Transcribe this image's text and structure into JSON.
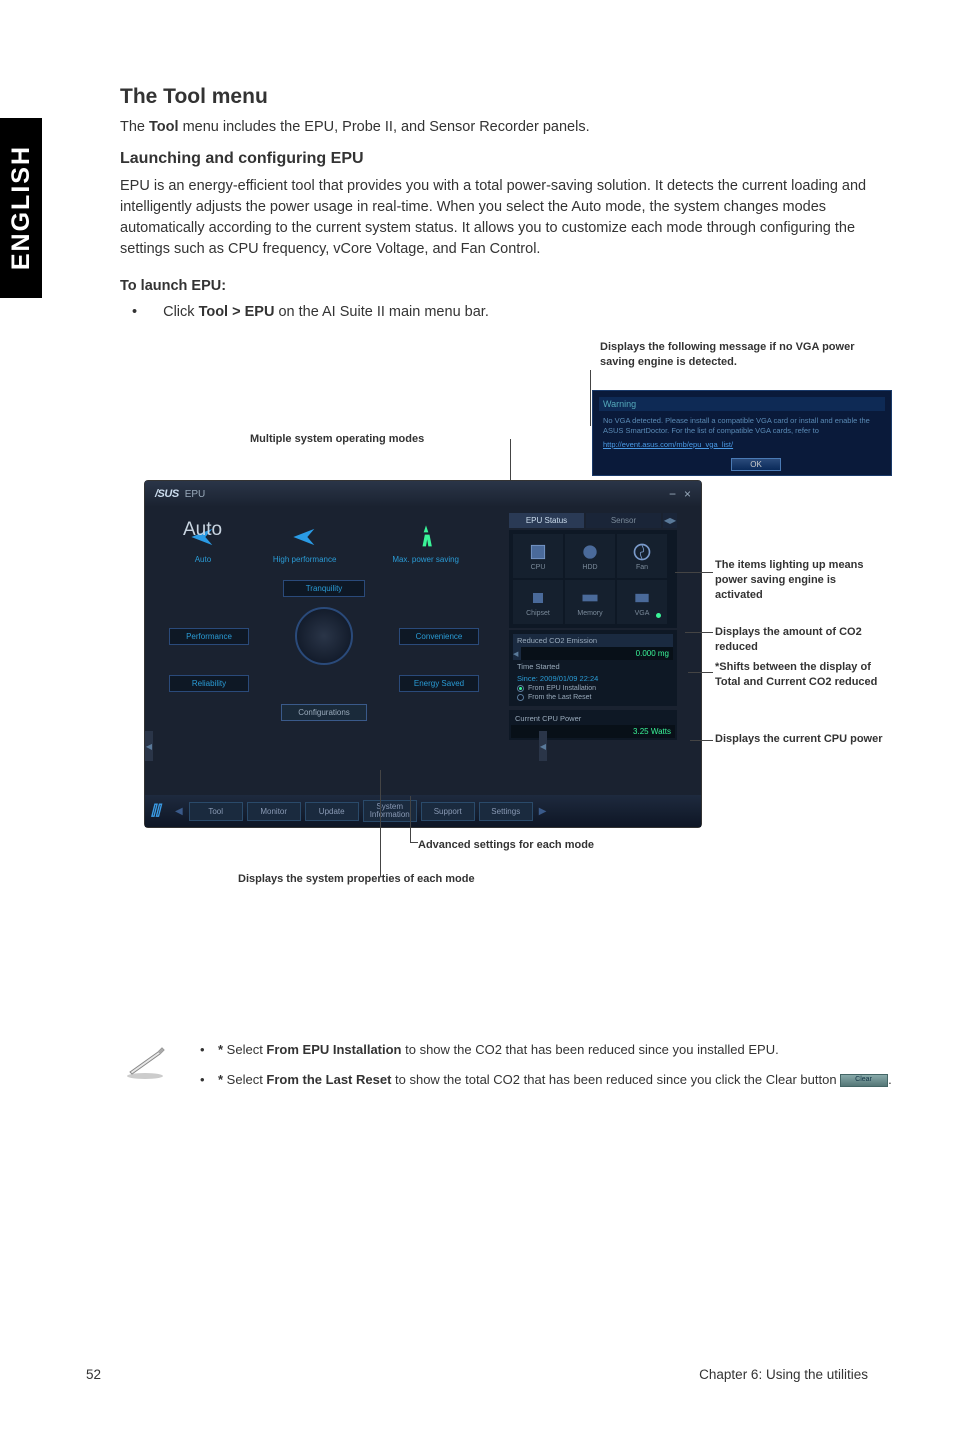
{
  "sideTab": "ENGLISH",
  "headings": {
    "toolMenu": "The Tool menu",
    "launchEpu": "Launching and configuring EPU",
    "toLaunch": "To launch EPU:"
  },
  "paras": {
    "toolIntro_pre": "The ",
    "toolIntro_bold": "Tool",
    "toolIntro_post": " menu includes the EPU, Probe II, and Sensor Recorder panels.",
    "epuDesc": "EPU is an energy-efficient tool that provides you with a total power-saving solution. It detects the current loading and intelligently adjusts the power usage in real-time. When you select the Auto mode, the system changes modes automatically according to the current system status. It allows you to customize each mode through configuring the settings such as CPU frequency, vCore Voltage, and Fan Control.",
    "launchStep_pre": "Click ",
    "launchStep_bold": "Tool > EPU",
    "launchStep_post": " on the AI Suite II main menu bar."
  },
  "callouts": {
    "warnMsg": "Displays the following message if no VGA power saving engine is detected.",
    "modes": "Multiple system operating modes",
    "items": "The items lighting up means power saving engine is activated",
    "co2": "Displays the amount of CO2 reduced",
    "shift": "*Shifts between the display of Total and Current CO2 reduced",
    "power": "Displays the current CPU power",
    "adv": "Advanced settings for each mode",
    "props": "Displays the system properties of each mode"
  },
  "warnDialog": {
    "title": "Warning",
    "text": "No VGA detected. Please install a compatible VGA card or install and enable the ASUS SmartDoctor. For the list of compatible VGA cards, refer to",
    "link": "http://event.asus.com/mb/epu_vga_list/",
    "ok": "OK"
  },
  "epu": {
    "brand": "/SUS",
    "title": "EPU",
    "autoBig": "Auto",
    "modes": {
      "auto": "Auto",
      "high": "High performance",
      "max": "Max. power saving"
    },
    "tranq": "Tranquility",
    "perf": "Performance",
    "conv": "Convenience",
    "rel": "Reliability",
    "energy": "Energy Saved",
    "config": "Configurations",
    "tabs": {
      "status": "EPU Status",
      "sensor": "Sensor"
    },
    "status": {
      "cpu": "CPU",
      "hdd": "HDD",
      "fan": "Fan",
      "chipset": "Chipset",
      "memory": "Memory",
      "vga": "VGA"
    },
    "emission": {
      "hdr": "Reduced CO2 Emission",
      "val": "0.000 mg",
      "timeStarted": "Time Started",
      "since": "Since: 2009/01/09 22:24",
      "fromInstall": "From EPU Installation",
      "fromReset": "From the Last Reset"
    },
    "currPower": {
      "hdr": "Current CPU Power",
      "val": "3.25 Watts"
    },
    "nav": {
      "tool": "Tool",
      "monitor": "Monitor",
      "update": "Update",
      "sysinfo1": "System",
      "sysinfo2": "Information",
      "support": "Support",
      "settings": "Settings"
    }
  },
  "notes": {
    "n1_pre": "*",
    "n1_sel": " Select ",
    "n1_bold": "From EPU Installation",
    "n1_post": " to show the CO2 that has been reduced since you installed EPU.",
    "n2_pre": "*",
    "n2_sel": " Select ",
    "n2_bold": "From the Last Reset",
    "n2_post": " to show the total CO2 that has been reduced since you click the Clear button ",
    "n2_end": "."
  },
  "footer": {
    "page": "52",
    "chapter": "Chapter 6: Using the utilities"
  }
}
